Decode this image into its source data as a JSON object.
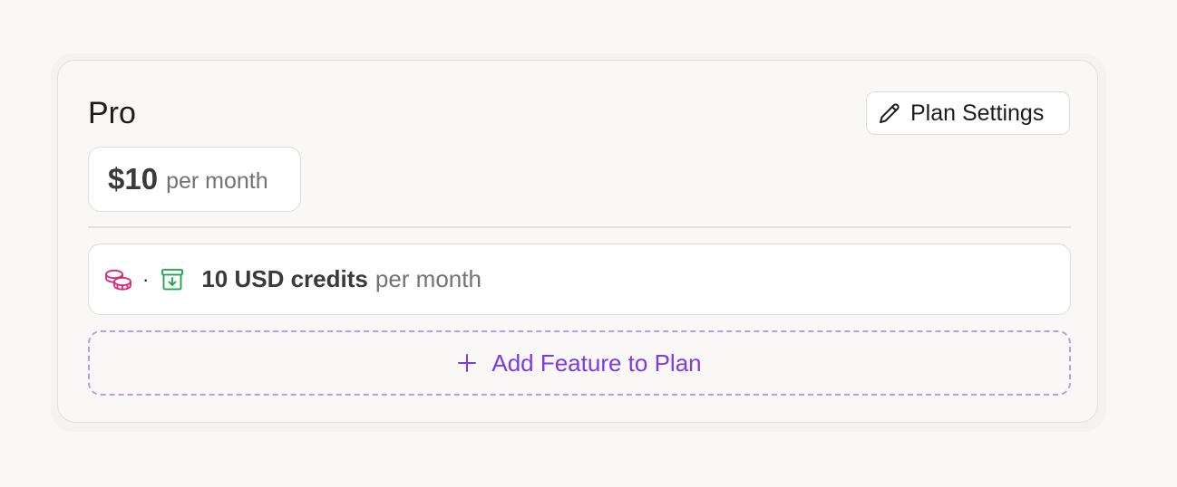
{
  "plan": {
    "name": "Pro",
    "settings_button_label": "Plan Settings",
    "price": {
      "amount": "$10",
      "period": "per month"
    }
  },
  "features": [
    {
      "icons": [
        "coins-icon",
        "archive-download-icon"
      ],
      "separator": "·",
      "label": "10 USD credits",
      "period": "per month"
    }
  ],
  "add_feature": {
    "label": "Add Feature to Plan",
    "icon": "plus-icon"
  },
  "colors": {
    "accent": "#7c3aed",
    "dashed_border": "#b99af0",
    "coins_icon": "#db2777",
    "archive_icon": "#16a34a"
  }
}
